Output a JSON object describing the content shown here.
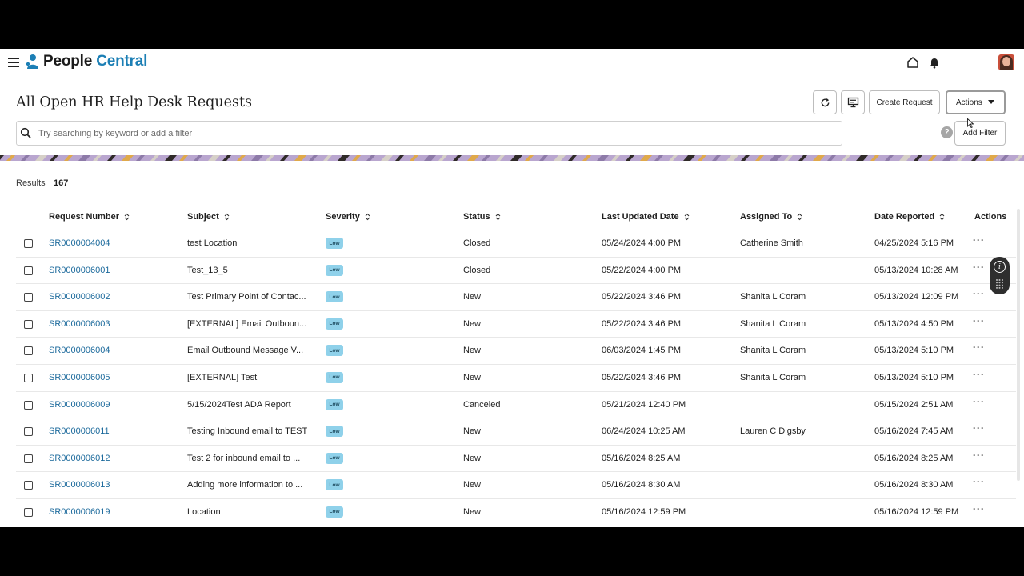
{
  "app": {
    "brand_part1": "People",
    "brand_part2": " Central",
    "brand_color": "#1c7fb5"
  },
  "header": {
    "title": "All Open HR Help Desk Requests",
    "create_label": "Create Request",
    "actions_label": "Actions"
  },
  "search": {
    "placeholder": "Try searching by keyword or add a filter",
    "value": "",
    "help_label": "?",
    "add_filter_label": "Add Filter"
  },
  "results": {
    "label": "Results",
    "count": "167"
  },
  "table": {
    "columns": {
      "request_number": "Request Number",
      "subject": "Subject",
      "severity": "Severity",
      "status": "Status",
      "last_updated": "Last Updated Date",
      "assigned_to": "Assigned To",
      "date_reported": "Date Reported",
      "actions": "Actions"
    },
    "rows": [
      {
        "number": "SR0000004004",
        "subject": "test Location",
        "severity": "Low",
        "status": "Closed",
        "updated": "05/24/2024 4:00 PM",
        "assigned": "Catherine Smith",
        "reported": "04/25/2024 5:16 PM",
        "more": "···"
      },
      {
        "number": "SR0000006001",
        "subject": "Test_13_5",
        "severity": "Low",
        "status": "Closed",
        "updated": "05/22/2024 4:00 PM",
        "assigned": "",
        "reported": "05/13/2024 10:28 AM",
        "more": "···"
      },
      {
        "number": "SR0000006002",
        "subject": "Test Primary Point of Contac...",
        "severity": "Low",
        "status": "New",
        "updated": "05/22/2024 3:46 PM",
        "assigned": "Shanita L Coram",
        "reported": "05/13/2024 12:09 PM",
        "more": "···"
      },
      {
        "number": "SR0000006003",
        "subject": "[EXTERNAL] Email Outboun...",
        "severity": "Low",
        "status": "New",
        "updated": "05/22/2024 3:46 PM",
        "assigned": "Shanita L Coram",
        "reported": "05/13/2024 4:50 PM",
        "more": "···"
      },
      {
        "number": "SR0000006004",
        "subject": "Email Outbound Message V...",
        "severity": "Low",
        "status": "New",
        "updated": "06/03/2024 1:45 PM",
        "assigned": "Shanita L Coram",
        "reported": "05/13/2024 5:10 PM",
        "more": "···"
      },
      {
        "number": "SR0000006005",
        "subject": "[EXTERNAL] Test",
        "severity": "Low",
        "status": "New",
        "updated": "05/22/2024 3:46 PM",
        "assigned": "Shanita L Coram",
        "reported": "05/13/2024 5:10 PM",
        "more": "···"
      },
      {
        "number": "SR0000006009",
        "subject": "5/15/2024Test ADA Report",
        "severity": "Low",
        "status": "Canceled",
        "updated": "05/21/2024 12:40 PM",
        "assigned": "",
        "reported": "05/15/2024 2:51 AM",
        "more": "···"
      },
      {
        "number": "SR0000006011",
        "subject": "Testing Inbound email to TEST",
        "severity": "Low",
        "status": "New",
        "updated": "06/24/2024 10:25 AM",
        "assigned": "Lauren C Digsby",
        "reported": "05/16/2024 7:45 AM",
        "more": "···"
      },
      {
        "number": "SR0000006012",
        "subject": "Test 2 for inbound email to ...",
        "severity": "Low",
        "status": "New",
        "updated": "05/16/2024 8:25 AM",
        "assigned": "",
        "reported": "05/16/2024 8:25 AM",
        "more": "···"
      },
      {
        "number": "SR0000006013",
        "subject": "Adding more information to ...",
        "severity": "Low",
        "status": "New",
        "updated": "05/16/2024 8:30 AM",
        "assigned": "",
        "reported": "05/16/2024 8:30 AM",
        "more": "···"
      },
      {
        "number": "SR0000006019",
        "subject": "Location",
        "severity": "Low",
        "status": "New",
        "updated": "05/16/2024 12:59 PM",
        "assigned": "",
        "reported": "05/16/2024 12:59 PM",
        "more": "···"
      }
    ]
  },
  "floating_widget": {
    "info_label": "i"
  }
}
